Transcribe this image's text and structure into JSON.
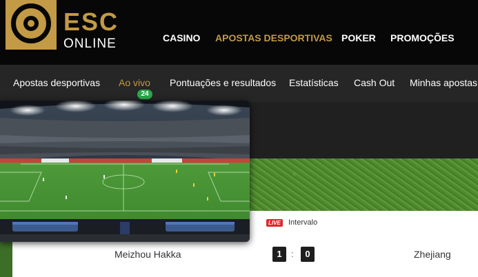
{
  "logo": {
    "top": "ESC",
    "bottom": "ONLINE",
    "brand_color": "#c39a45"
  },
  "topnav": [
    {
      "label": "CASINO"
    },
    {
      "label": "APOSTAS DESPORTIVAS",
      "active": true
    },
    {
      "label": "POKER"
    },
    {
      "label": "PROMOÇÕES"
    }
  ],
  "subnav": [
    {
      "label": "Apostas desportivas"
    },
    {
      "label": "Ao vivo",
      "active": true,
      "badge": "24"
    },
    {
      "label": "Pontuações e resultados"
    },
    {
      "label": "Estatísticas"
    },
    {
      "label": "Cash Out"
    },
    {
      "label": "Minhas apostas"
    }
  ],
  "match": {
    "live_label": "LIVE",
    "status": "Intervalo",
    "home": "Meizhou Hakka",
    "away": "Zhejiang",
    "home_score": "1",
    "away_score": "0",
    "separator": ":"
  },
  "colors": {
    "live_badge": "#2aa84a",
    "live_tag": "#e3262b",
    "active": "#c39a45"
  },
  "video": {
    "icon": "stadium-video-preview"
  }
}
